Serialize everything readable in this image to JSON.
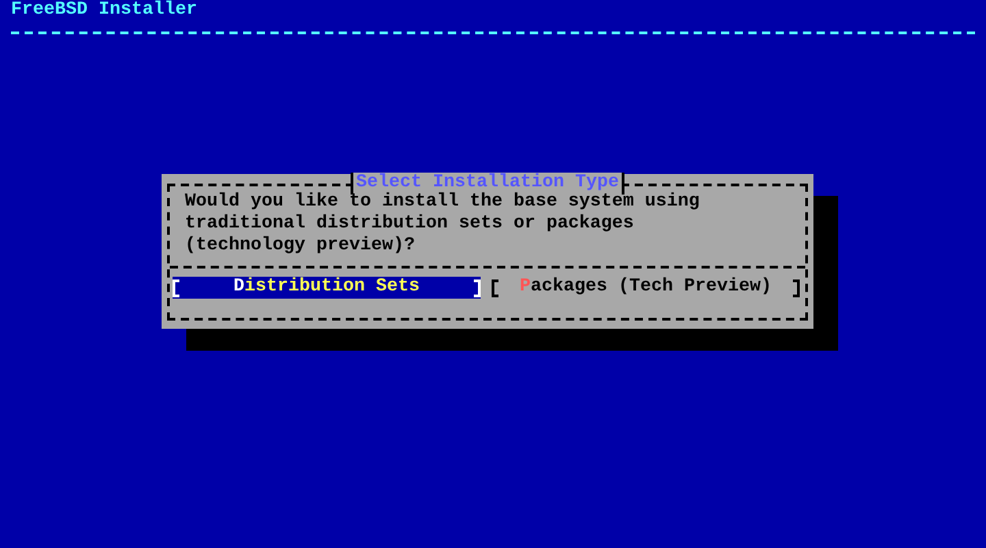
{
  "header": {
    "title": "FreeBSD Installer"
  },
  "dialog": {
    "title": "Select Installation Type",
    "message": "Would you like to install the base system using traditional distribution sets or packages (technology preview)?",
    "buttons": [
      {
        "label": "Distribution Sets",
        "selected": true
      },
      {
        "label": "Packages (Tech Preview)",
        "selected": false
      }
    ]
  }
}
